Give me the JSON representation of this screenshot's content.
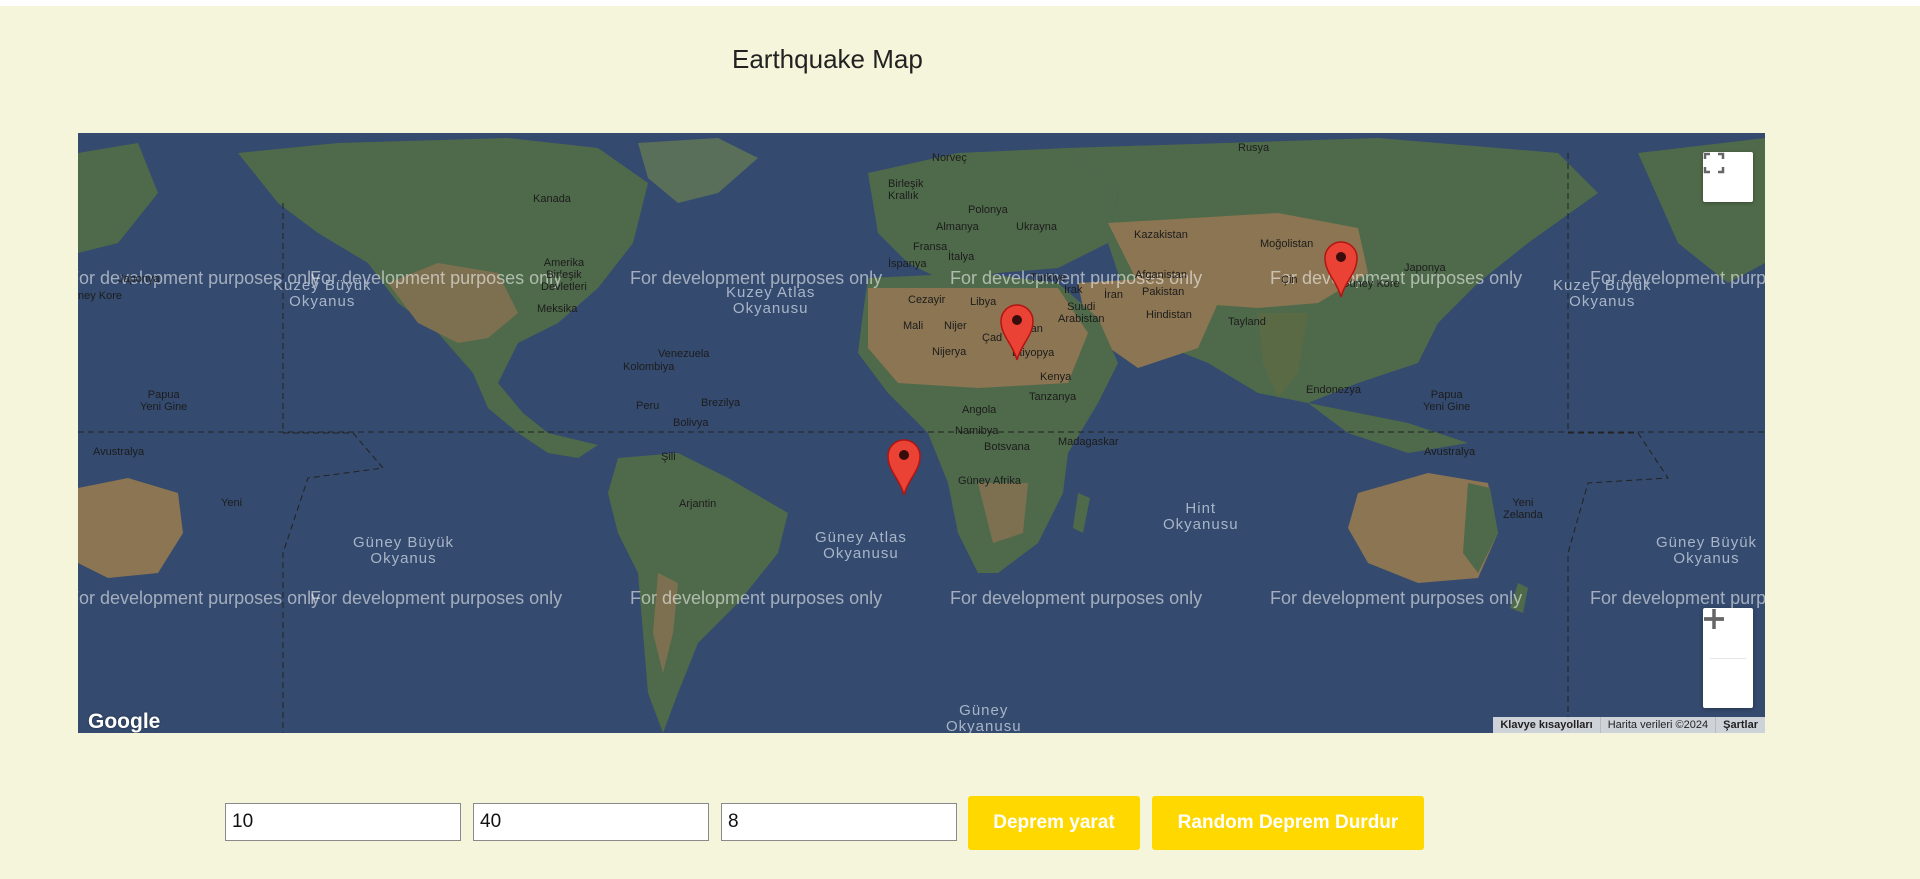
{
  "page": {
    "title": "Earthquake Map"
  },
  "map": {
    "watermark": "For development purposes only",
    "google_logo": "Google",
    "attribution": {
      "shortcuts": "Klavye kısayolları",
      "data": "Harita verileri ©2024",
      "terms": "Şartlar"
    },
    "markers": [
      {
        "name": "marker-south-atlantic",
        "icon": "map-pin-icon"
      },
      {
        "name": "marker-egypt",
        "icon": "map-pin-icon"
      },
      {
        "name": "marker-china",
        "icon": "map-pin-icon"
      }
    ],
    "countries": {
      "norvec": "Norveç",
      "rusya": "Rusya",
      "kanada": "Kanada",
      "birlesik_krallik": "Birleşik\nKrallık",
      "polonya": "Polonya",
      "almanya": "Almanya",
      "ukrayna": "Ukrayna",
      "fransa": "Fransa",
      "kazakistan": "Kazakistan",
      "mogolistan": "Moğolistan",
      "japonya": "Japonya",
      "guney_kore": "Güney Kore",
      "amerika": "Amerika\nBirleşik\nDevletleri",
      "italya": "İtalya",
      "ispanya": "İspanya",
      "turkiye": "Türkiye",
      "cin": "Çin",
      "cezayir": "Cezayir",
      "libya": "Libya",
      "irak": "Irak",
      "iran": "İran",
      "afganistan": "Afganistan",
      "pakistan": "Pakistan",
      "suudi": "Suudi\nArabistan",
      "hindistan": "Hindistan",
      "meksika": "Meksika",
      "mali": "Mali",
      "nijer": "Nijer",
      "cad": "Çad",
      "sudan": "Sudan",
      "tayland": "Tayland",
      "nijerya": "Nijerya",
      "etiyopya": "Etiyopya",
      "venezuela": "Venezuela",
      "kolombiya": "Kolombiya",
      "kenya": "Kenya",
      "endonezya": "Endonezya",
      "papua": "Papua\nYeni Gine",
      "peru": "Peru",
      "brezilya": "Brezilya",
      "tanzanya": "Tanzanya",
      "angola": "Angola",
      "bolivya": "Bolivya",
      "namibya": "Namibya",
      "madagaskar": "Madagaskar",
      "botsvana": "Botsvana",
      "avustralya": "Avustralya",
      "sili": "Şili",
      "guney_afrika": "Güney Afrika",
      "arjantin": "Arjantin",
      "yeni_zelanda": "Yeni\nZelanda",
      "japonya_left": "Japonya",
      "guney_kore_left": "ney Kore",
      "avustralya_left": "Avustralya",
      "papua_left": "Papua\nYeni Gine",
      "yeni_left": "Yeni"
    },
    "oceans": {
      "kuzey_buyuk_left": "Kuzey Büyük\nOkyanus",
      "kuzey_atlas": "Kuzey Atlas\nOkyanusu",
      "kuzey_buyuk_right": "Kuzey Büyük\nOkyanus",
      "guney_buyuk_left": "Güney Büyük\nOkyanus",
      "guney_atlas": "Güney Atlas\nOkyanusu",
      "hint": "Hint\nOkyanusu",
      "guney_buyuk_right": "Güney Büyük\nOkyanus",
      "guney": "Güney\nOkyanusu"
    }
  },
  "controls": {
    "input1": "10",
    "input2": "40",
    "input3": "8",
    "create_button": "Deprem yarat",
    "stop_button": "Random Deprem Durdur"
  },
  "colors": {
    "page_bg": "#f5f5dc",
    "ocean": "#344a6e",
    "land_green": "#4f6a4a",
    "land_desert": "#8c7552",
    "button_yellow": "#ffd800",
    "marker_red": "#ea4335"
  }
}
